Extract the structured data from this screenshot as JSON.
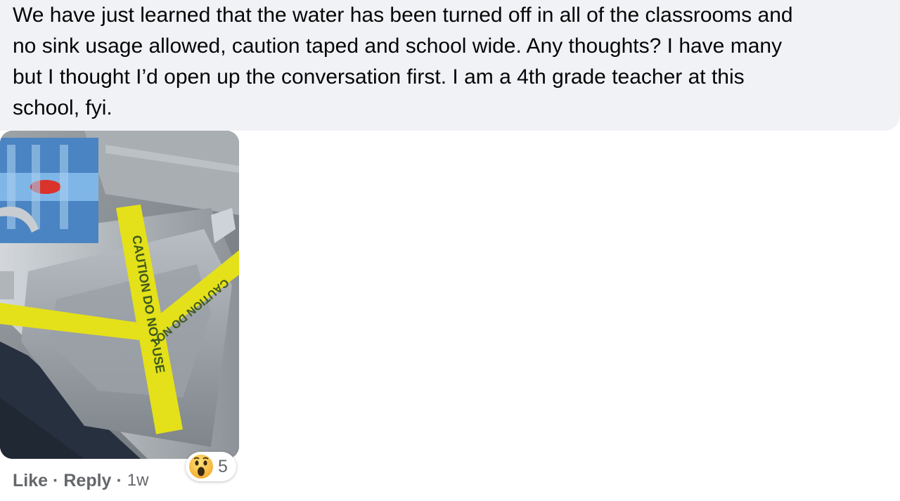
{
  "comment": {
    "text": "We have just learned that the water has been turned off in all of the classrooms and\nno sink usage allowed, caution taped and school wide. Any thoughts? I have many\nbut I thought I’d open up the conversation first. I am a 4th grade teacher at this\nschool, fyi."
  },
  "photo": {
    "tape_text_1": "CAUTION DO NOT USE",
    "tape_text_2": "CAUTION DO NOT"
  },
  "actions": {
    "like": "Like",
    "reply": "Reply",
    "separator": "·",
    "time": "1w"
  },
  "reactions": {
    "icon": "wow-emoji-icon",
    "count": "5"
  },
  "colors": {
    "bubble": "#f0f2f5",
    "meta": "#65676b",
    "tape": "#e4e01a"
  }
}
